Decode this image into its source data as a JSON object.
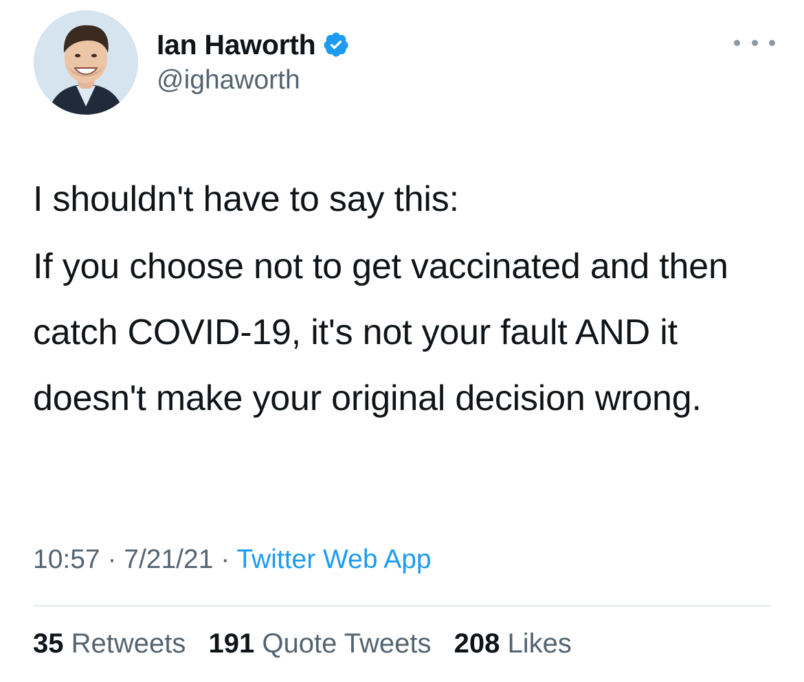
{
  "author": {
    "display_name": "Ian Haworth",
    "handle": "@ighaworth",
    "verified_icon": "verified-badge-icon",
    "avatar_icon": "avatar-photo"
  },
  "more_icon": "more-options-icon",
  "tweet": {
    "paragraphs": [
      "I shouldn't have to say this:",
      "If you choose not to get vaccinated and then catch COVID-19, it's not your fault AND it doesn't make your original decision wrong."
    ]
  },
  "meta": {
    "time": "10:57",
    "separator": " · ",
    "date": "7/21/21",
    "source": "Twitter Web App"
  },
  "stats": {
    "retweets": {
      "count": "35",
      "label": "Retweets"
    },
    "quote_tweets": {
      "count": "191",
      "label": "Quote Tweets"
    },
    "likes": {
      "count": "208",
      "label": "Likes"
    }
  },
  "colors": {
    "accent": "#1d9bf0",
    "text": "#0f1419",
    "secondary": "#536471",
    "divider": "#e3e7ea"
  }
}
